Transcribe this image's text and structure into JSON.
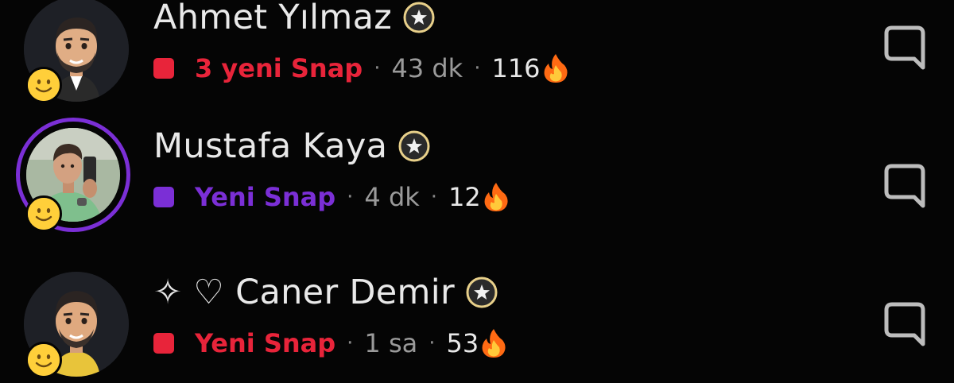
{
  "chats": [
    {
      "name": "Ahmet Yılmaz",
      "name_prefix": "",
      "snap_label": "3 yeni Snap",
      "snap_color": "#e8243a",
      "time": "43 dk",
      "streak": "116",
      "avatar": "bitmoji-avatar",
      "has_story_ring": false,
      "icons": [
        "star-badge-icon",
        "fire-icon",
        "chat-icon",
        "smiley-icon"
      ]
    },
    {
      "name": "Mustafa Kaya",
      "name_prefix": "",
      "snap_label": "Yeni Snap",
      "snap_color": "#7b2fd6",
      "time": "4 dk",
      "streak": "12",
      "avatar": "photo-avatar",
      "has_story_ring": true,
      "story_ring_color": "#7b2fd6",
      "icons": [
        "star-badge-icon",
        "fire-icon",
        "chat-icon",
        "smiley-icon"
      ]
    },
    {
      "name": "Caner Demir",
      "name_prefix": "✧ ♡",
      "snap_label": "Yeni Snap",
      "snap_color": "#e8243a",
      "time": "1 sa",
      "streak": "53",
      "avatar": "bitmoji-avatar",
      "has_story_ring": false,
      "icons": [
        "star-badge-icon",
        "fire-icon",
        "chat-icon",
        "smiley-icon"
      ]
    }
  ],
  "separator": "·",
  "colors": {
    "background": "#050505",
    "name_text": "#e9e9e9",
    "meta_text": "#9a9a9a",
    "star_badge_ring": "#e8d08a"
  }
}
